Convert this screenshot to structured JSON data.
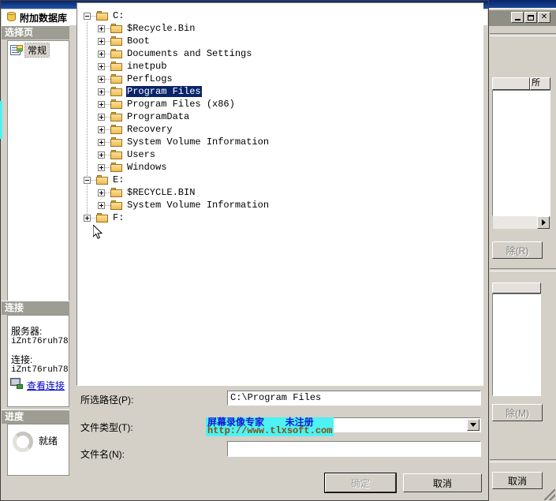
{
  "background_window": {
    "title_buttons": [
      "minimize",
      "maximize",
      "close"
    ],
    "list_header_label": "所",
    "button_remove_r": "除(R)",
    "button_remove_m": "除(M)",
    "button_cancel": "取消"
  },
  "dialog": {
    "title": "附加数据库",
    "select_page_header": "选择页",
    "select_page_items": [
      {
        "label": "常规",
        "selected": true
      }
    ],
    "connection_header": "连接",
    "connection": {
      "server_label": "服务器:",
      "server_value": "iZnt76ruh78",
      "connection_label": "连接:",
      "connection_value": "iZnt76ruh78",
      "view_connection_link": "查看连接"
    },
    "progress_header": "进度",
    "progress_status": "就绪"
  },
  "tree": {
    "nodes": [
      {
        "label": "C:",
        "depth": 0,
        "expander": "minus",
        "selected": false
      },
      {
        "label": "$Recycle.Bin",
        "depth": 1,
        "expander": "plus",
        "selected": false
      },
      {
        "label": "Boot",
        "depth": 1,
        "expander": "plus",
        "selected": false
      },
      {
        "label": "Documents and Settings",
        "depth": 1,
        "expander": "plus",
        "selected": false
      },
      {
        "label": "inetpub",
        "depth": 1,
        "expander": "plus",
        "selected": false
      },
      {
        "label": "PerfLogs",
        "depth": 1,
        "expander": "plus",
        "selected": false
      },
      {
        "label": "Program Files",
        "depth": 1,
        "expander": "plus",
        "selected": true
      },
      {
        "label": "Program Files (x86)",
        "depth": 1,
        "expander": "plus",
        "selected": false
      },
      {
        "label": "ProgramData",
        "depth": 1,
        "expander": "plus",
        "selected": false
      },
      {
        "label": "Recovery",
        "depth": 1,
        "expander": "plus",
        "selected": false
      },
      {
        "label": "System Volume Information",
        "depth": 1,
        "expander": "plus",
        "selected": false
      },
      {
        "label": "Users",
        "depth": 1,
        "expander": "plus",
        "selected": false
      },
      {
        "label": "Windows",
        "depth": 1,
        "expander": "plus",
        "selected": false
      },
      {
        "label": "E:",
        "depth": 0,
        "expander": "minus",
        "selected": false
      },
      {
        "label": "$RECYCLE.BIN",
        "depth": 1,
        "expander": "plus",
        "selected": false
      },
      {
        "label": "System Volume Information",
        "depth": 1,
        "expander": "plus",
        "selected": false
      },
      {
        "label": "F:",
        "depth": 0,
        "expander": "plus",
        "selected": false
      }
    ]
  },
  "form": {
    "selected_path_label": "所选路径(P):",
    "selected_path_value": "C:\\Program Files",
    "file_type_label": "文件类型(T):",
    "file_type_value": "",
    "file_name_label": "文件名(N):",
    "file_name_value": "",
    "ok_button": "确定",
    "cancel_button": "取消"
  },
  "watermark": {
    "line1": "屏幕录像专家        未注册",
    "line2": "http://www.tlxsoft.com",
    "bg_color": "#4df2f2",
    "line1_color": "#1919d0",
    "line2_color": "#8a4a10"
  }
}
